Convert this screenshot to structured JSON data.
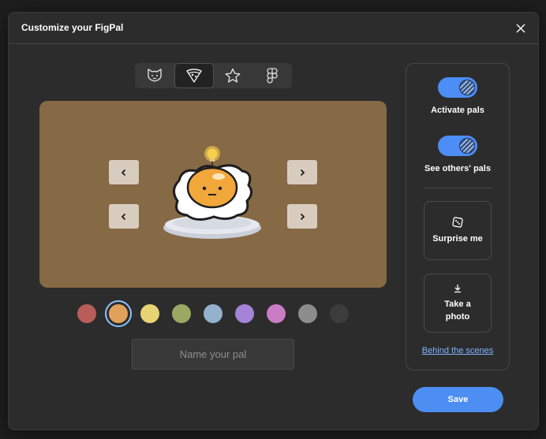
{
  "modal": {
    "title": "Customize your FigPal"
  },
  "tabs": [
    {
      "icon": "cat-icon"
    },
    {
      "icon": "pizza-icon",
      "active": true
    },
    {
      "icon": "star-icon"
    },
    {
      "icon": "figma-icon"
    }
  ],
  "stage": {
    "background": "#866945"
  },
  "swatches": [
    {
      "color": "#b95d5a"
    },
    {
      "color": "#e1a15a",
      "selected": true
    },
    {
      "color": "#e6d474"
    },
    {
      "color": "#9aa864"
    },
    {
      "color": "#94b1cd"
    },
    {
      "color": "#a584d8"
    },
    {
      "color": "#c97cc4"
    },
    {
      "color": "#8c8c8c"
    },
    {
      "color": "#3c3c3c"
    }
  ],
  "name_input": {
    "placeholder": "Name your pal",
    "value": ""
  },
  "side": {
    "activate_label": "Activate pals",
    "others_label": "See others' pals",
    "surprise_label": "Surprise me",
    "photo_label_line1": "Take a",
    "photo_label_line2": "photo",
    "link_label": "Behind the scenes"
  },
  "save_label": "Save",
  "colors": {
    "accent": "#4c8ef2",
    "link": "#7fb5ff"
  }
}
